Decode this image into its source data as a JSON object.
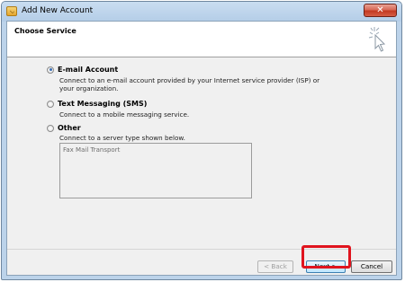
{
  "window": {
    "title": "Add New Account"
  },
  "header": {
    "title": "Choose Service"
  },
  "options": [
    {
      "label": "E-mail Account",
      "description": "Connect to an e-mail account provided by your Internet service provider (ISP) or your organization.",
      "checked": true
    },
    {
      "label": "Text Messaging (SMS)",
      "description": "Connect to a mobile messaging service.",
      "checked": false
    },
    {
      "label": "Other",
      "description": "Connect to a server type shown below.",
      "checked": false
    }
  ],
  "server_types": [
    "Fax Mail Transport"
  ],
  "buttons": {
    "back": "< Back",
    "next": "Next >",
    "cancel": "Cancel"
  },
  "colors": {
    "highlight": "#e0141e",
    "titlebar": "#bcd3ea",
    "close_button": "#c33a22"
  },
  "icons": {
    "close": "close-icon",
    "wizard": "wand-sparkle-icon"
  }
}
